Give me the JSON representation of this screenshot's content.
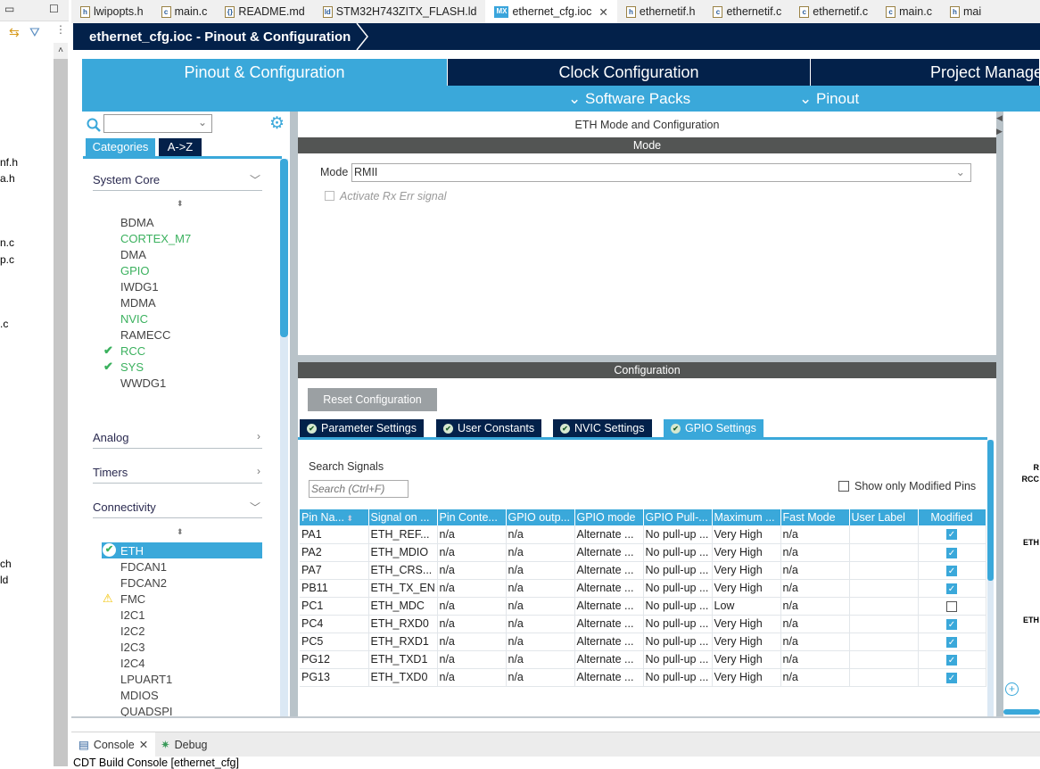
{
  "explorer": {
    "fragments": [
      "nf.h",
      "a.h",
      "n.c",
      "p.c",
      ".c",
      "ch",
      "ld"
    ]
  },
  "editor_tabs": [
    {
      "label": "lwipopts.h",
      "icon": "h"
    },
    {
      "label": "main.c",
      "icon": "c"
    },
    {
      "label": "README.md",
      "icon": "{}"
    },
    {
      "label": "STM32H743ZITX_FLASH.ld",
      "icon": "ld"
    },
    {
      "label": "ethernet_cfg.ioc",
      "icon": "MX",
      "active": true
    },
    {
      "label": "ethernetif.h",
      "icon": "h"
    },
    {
      "label": "ethernetif.c",
      "icon": "c"
    },
    {
      "label": "ethernetif.c",
      "icon": "c"
    },
    {
      "label": "main.c",
      "icon": "c"
    },
    {
      "label": "mai",
      "icon": "h"
    }
  ],
  "breadcrumb": "ethernet_cfg.ioc - Pinout & Configuration",
  "main_tabs": [
    "Pinout & Configuration",
    "Clock Configuration",
    "Project Manage"
  ],
  "sub_menus": [
    "Software Packs",
    "Pinout"
  ],
  "left": {
    "tabs": [
      "Categories",
      "A->Z"
    ],
    "categories": {
      "system_core": "System Core",
      "analog": "Analog",
      "timers": "Timers",
      "connectivity": "Connectivity"
    },
    "system_core_items": [
      {
        "label": "BDMA",
        "status": "none"
      },
      {
        "label": "CORTEX_M7",
        "status": "green"
      },
      {
        "label": "DMA",
        "status": "none"
      },
      {
        "label": "GPIO",
        "status": "green"
      },
      {
        "label": "IWDG1",
        "status": "none"
      },
      {
        "label": "MDMA",
        "status": "none"
      },
      {
        "label": "NVIC",
        "status": "green"
      },
      {
        "label": "RAMECC",
        "status": "none"
      },
      {
        "label": "RCC",
        "status": "check"
      },
      {
        "label": "SYS",
        "status": "check"
      },
      {
        "label": "WWDG1",
        "status": "none"
      }
    ],
    "connectivity_items": [
      {
        "label": "ETH",
        "status": "selected"
      },
      {
        "label": "FDCAN1",
        "status": "none"
      },
      {
        "label": "FDCAN2",
        "status": "none"
      },
      {
        "label": "FMC",
        "status": "warning"
      },
      {
        "label": "I2C1",
        "status": "none"
      },
      {
        "label": "I2C2",
        "status": "none"
      },
      {
        "label": "I2C3",
        "status": "none"
      },
      {
        "label": "I2C4",
        "status": "none"
      },
      {
        "label": "LPUART1",
        "status": "none"
      },
      {
        "label": "MDIOS",
        "status": "none"
      },
      {
        "label": "QUADSPI",
        "status": "none"
      }
    ]
  },
  "right": {
    "title": "ETH Mode and Configuration",
    "mode_header": "Mode",
    "mode_label": "Mode",
    "mode_value": "RMII",
    "rx_err_label": "Activate Rx Err signal",
    "config_header": "Configuration",
    "reset_button": "Reset Configuration",
    "config_tabs": [
      "Parameter Settings",
      "User Constants",
      "NVIC Settings",
      "GPIO Settings"
    ],
    "search_label": "Search Signals",
    "search_placeholder": "Search (Ctrl+F)",
    "show_modified_label": "Show only Modified Pins",
    "table": {
      "columns": [
        "Pin Na...",
        "Signal on ...",
        "Pin Conte...",
        "GPIO outp...",
        "GPIO mode",
        "GPIO Pull-...",
        "Maximum ...",
        "Fast Mode",
        "User Label",
        "Modified"
      ],
      "rows": [
        [
          "PA1",
          "ETH_REF...",
          "n/a",
          "n/a",
          "Alternate ...",
          "No pull-up ...",
          "Very High",
          "n/a",
          "",
          true
        ],
        [
          "PA2",
          "ETH_MDIO",
          "n/a",
          "n/a",
          "Alternate ...",
          "No pull-up ...",
          "Very High",
          "n/a",
          "",
          true
        ],
        [
          "PA7",
          "ETH_CRS...",
          "n/a",
          "n/a",
          "Alternate ...",
          "No pull-up ...",
          "Very High",
          "n/a",
          "",
          true
        ],
        [
          "PB11",
          "ETH_TX_EN",
          "n/a",
          "n/a",
          "Alternate ...",
          "No pull-up ...",
          "Very High",
          "n/a",
          "",
          true
        ],
        [
          "PC1",
          "ETH_MDC",
          "n/a",
          "n/a",
          "Alternate ...",
          "No pull-up ...",
          "Low",
          "n/a",
          "",
          false
        ],
        [
          "PC4",
          "ETH_RXD0",
          "n/a",
          "n/a",
          "Alternate ...",
          "No pull-up ...",
          "Very High",
          "n/a",
          "",
          true
        ],
        [
          "PC5",
          "ETH_RXD1",
          "n/a",
          "n/a",
          "Alternate ...",
          "No pull-up ...",
          "Very High",
          "n/a",
          "",
          true
        ],
        [
          "PG12",
          "ETH_TXD1",
          "n/a",
          "n/a",
          "Alternate ...",
          "No pull-up ...",
          "Very High",
          "n/a",
          "",
          true
        ],
        [
          "PG13",
          "ETH_TXD0",
          "n/a",
          "n/a",
          "Alternate ...",
          "No pull-up ...",
          "Very High",
          "n/a",
          "",
          true
        ]
      ]
    }
  },
  "pinout_labels": [
    "R",
    "RCC",
    "ETH",
    "ETH"
  ],
  "bottom": {
    "tabs": [
      "Console",
      "Debug"
    ],
    "console_text": "CDT Build Console [ethernet_cfg]"
  },
  "colors": {
    "navy": "#03214a",
    "accent": "#3aa8da",
    "green": "#3bb15e",
    "bar": "#535554"
  }
}
